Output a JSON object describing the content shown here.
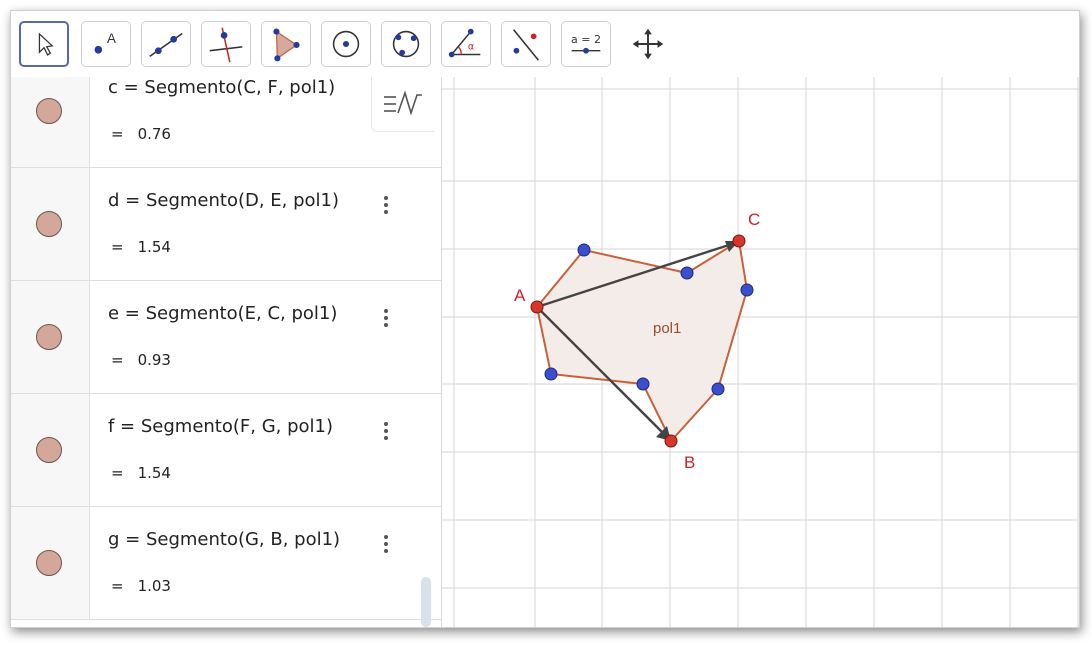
{
  "toolbar": {
    "tools": [
      {
        "name": "move-tool",
        "label": ""
      },
      {
        "name": "point-tool",
        "label": "A"
      },
      {
        "name": "line-tool",
        "label": ""
      },
      {
        "name": "perpendicular-line-tool",
        "label": ""
      },
      {
        "name": "polygon-tool",
        "label": ""
      },
      {
        "name": "circle-tool",
        "label": ""
      },
      {
        "name": "circle-three-points-tool",
        "label": ""
      },
      {
        "name": "angle-tool",
        "label": "α"
      },
      {
        "name": "reflect-tool",
        "label": ""
      },
      {
        "name": "slider-tool",
        "label": "a = 2"
      },
      {
        "name": "move-graphics-view-tool",
        "label": ""
      }
    ]
  },
  "algebra": {
    "items": [
      {
        "definition": "c = Segmento(C, F, pol1)",
        "value": "0.76"
      },
      {
        "definition": "d = Segmento(D, E, pol1)",
        "value": "1.54"
      },
      {
        "definition": "e = Segmento(E, C, pol1)",
        "value": "0.93"
      },
      {
        "definition": "f = Segmento(F, G, pol1)",
        "value": "1.54"
      },
      {
        "definition": "g = Segmento(G, B, pol1)",
        "value": "1.03"
      }
    ],
    "equals": "="
  },
  "graphics": {
    "points": {
      "A": "A",
      "B": "B",
      "C": "C"
    },
    "polygon_label": "pol1",
    "colors": {
      "point_red": "#d8352c",
      "point_blue": "#3a4fd0",
      "polygon_edge": "#c8603a",
      "polygon_fill": "#f4ece9",
      "vector": "#444444",
      "grid": "#d6d6d6"
    }
  }
}
